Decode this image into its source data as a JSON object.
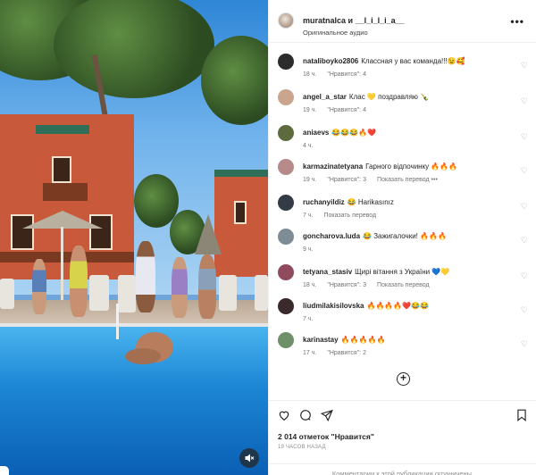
{
  "post": {
    "author_line": "muratnalca и __l_i_l_i_a__",
    "audio": "Оригинальное аудио",
    "more_icon": "more-horizontal-icon"
  },
  "comments": [
    {
      "user": "nataliboyko2806",
      "text": "Классная у вас команда!!!😉🥰",
      "time": "18 ч.",
      "likes": "\"Нравится\": 4",
      "extra": "",
      "avatar_color": "#2b2b2b"
    },
    {
      "user": "angel_a_star",
      "text": "Клас 💛 поздравляю 🍾",
      "time": "19 ч.",
      "likes": "\"Нравится\": 4",
      "extra": "",
      "avatar_color": "#c9a58d"
    },
    {
      "user": "aniaevs",
      "text": "😂😂😂🔥❤️",
      "time": "4 ч.",
      "likes": "",
      "extra": "",
      "avatar_color": "#5e6b3f"
    },
    {
      "user": "karmazinatetyana",
      "text": "Гарного відпочинку 🔥🔥🔥",
      "time": "19 ч.",
      "likes": "\"Нравится\": 3",
      "extra": "Показать перевод  •••",
      "avatar_color": "#b58a88"
    },
    {
      "user": "ruchanyildiz",
      "text": "😂 Harikasınız",
      "time": "7 ч.",
      "likes": "",
      "extra": "Показать перевод",
      "avatar_color": "#343a46"
    },
    {
      "user": "goncharova.luda",
      "text": "😂 Зажигалочки! 🔥🔥🔥",
      "time": "9 ч.",
      "likes": "",
      "extra": "",
      "avatar_color": "#7d8c95"
    },
    {
      "user": "tetyana_stasiv",
      "text": "Щирі вітання з України 💙💛",
      "time": "18 ч.",
      "likes": "\"Нравится\": 3",
      "extra": "Показать перевод",
      "avatar_color": "#8f4b5b"
    },
    {
      "user": "liudmilakisilovska",
      "text": "🔥🔥🔥🔥❤️😂😂",
      "time": "7 ч.",
      "likes": "",
      "extra": "",
      "avatar_color": "#3a2a2a"
    },
    {
      "user": "karinastay",
      "text": "🔥🔥🔥🔥🔥",
      "time": "17 ч.",
      "likes": "\"Нравится\": 2",
      "extra": "",
      "avatar_color": "#6f8f6a"
    }
  ],
  "load_more_icon": "plus-circle-icon",
  "actions": {
    "likes_text": "2 014 отметок \"Нравится\"",
    "time_ago": "19 ЧАСОВ НАЗАД",
    "comments_closed": "Комментарии к этой публикации ограничены."
  },
  "media": {
    "mute_icon": "speaker-muted-icon"
  }
}
